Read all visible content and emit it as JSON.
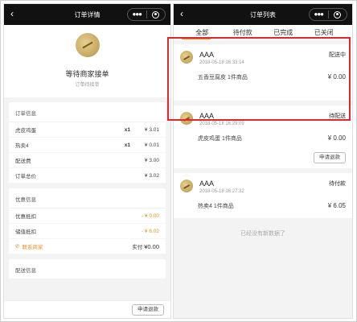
{
  "left": {
    "nav_title": "订单详情",
    "status_title": "等待商家接单",
    "status_sub": "订单待接单",
    "order_info": {
      "heading": "订单信息",
      "items": [
        {
          "name": "虎皮鸡蛋",
          "qty": "x1",
          "price": "¥ 3.01"
        },
        {
          "name": "热卖4",
          "qty": "x1",
          "price": "¥ 0.01"
        }
      ],
      "delivery_label": "配送费",
      "delivery_value": "¥ 3.00",
      "total_label": "订单总价",
      "total_value": "¥ 3.02"
    },
    "discount_info": {
      "heading": "优惠信息",
      "rows": [
        {
          "label": "优惠抵扣",
          "value": "- ¥ 0.00"
        },
        {
          "label": "储值抵扣",
          "value": "- ¥ 6.02"
        }
      ],
      "contact_label": "联系商家",
      "actual_label": "实付",
      "actual_value": "¥0.00"
    },
    "delivery_heading": "配送信息",
    "refund_button": "申请退款"
  },
  "right": {
    "nav_title": "订单列表",
    "tabs": [
      "全部",
      "待付款",
      "已完成",
      "已关闭"
    ],
    "orders": [
      {
        "shop": "AAA",
        "time": "2018-05-18 16:33:14",
        "state": "配送中",
        "goods": "五香豆腐皮 1件商品",
        "amount": "¥ 0.00"
      },
      {
        "shop": "AAA",
        "time": "2018-05-18 16:29:09",
        "state": "待配送",
        "goods": "虎皮鸡蛋 1件商品",
        "amount": "¥ 0.00",
        "action": "申请退款"
      },
      {
        "shop": "AAA",
        "time": "2018-05-18 16:27:32",
        "state": "待付款",
        "goods": "热卖4 1件商品",
        "amount": "¥ 6.05"
      }
    ],
    "end_note": "已经没有新数据了"
  },
  "colors": {
    "accent": "#e8912a",
    "highlight": "#e0282c",
    "navbar": "#111111"
  }
}
